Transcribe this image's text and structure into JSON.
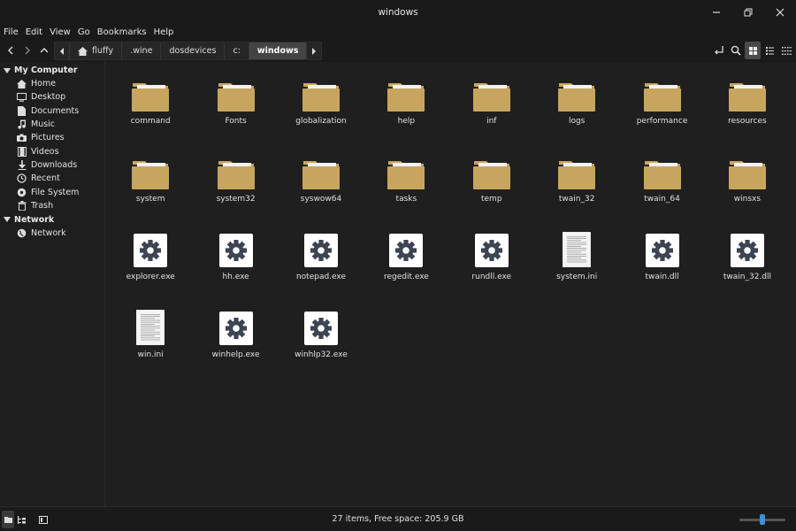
{
  "window": {
    "title": "windows"
  },
  "menu": [
    "File",
    "Edit",
    "View",
    "Go",
    "Bookmarks",
    "Help"
  ],
  "breadcrumbs": [
    {
      "label": "fluffy",
      "home": true
    },
    {
      "label": ".wine"
    },
    {
      "label": "dosdevices"
    },
    {
      "label": "c:"
    },
    {
      "label": "windows",
      "active": true
    }
  ],
  "sidebar": {
    "sections": [
      {
        "title": "My Computer",
        "items": [
          {
            "label": "Home",
            "icon": "home-icon"
          },
          {
            "label": "Desktop",
            "icon": "desktop-icon"
          },
          {
            "label": "Documents",
            "icon": "documents-icon"
          },
          {
            "label": "Music",
            "icon": "music-icon"
          },
          {
            "label": "Pictures",
            "icon": "pictures-icon"
          },
          {
            "label": "Videos",
            "icon": "videos-icon"
          },
          {
            "label": "Downloads",
            "icon": "downloads-icon"
          },
          {
            "label": "Recent",
            "icon": "recent-icon"
          },
          {
            "label": "File System",
            "icon": "filesystem-icon"
          },
          {
            "label": "Trash",
            "icon": "trash-icon"
          }
        ]
      },
      {
        "title": "Network",
        "items": [
          {
            "label": "Network",
            "icon": "network-icon"
          }
        ]
      }
    ]
  },
  "files": [
    {
      "name": "command",
      "type": "folder"
    },
    {
      "name": "Fonts",
      "type": "folder"
    },
    {
      "name": "globalization",
      "type": "folder"
    },
    {
      "name": "help",
      "type": "folder"
    },
    {
      "name": "inf",
      "type": "folder"
    },
    {
      "name": "logs",
      "type": "folder"
    },
    {
      "name": "performance",
      "type": "folder"
    },
    {
      "name": "resources",
      "type": "folder"
    },
    {
      "name": "system",
      "type": "folder"
    },
    {
      "name": "system32",
      "type": "folder"
    },
    {
      "name": "syswow64",
      "type": "folder"
    },
    {
      "name": "tasks",
      "type": "folder"
    },
    {
      "name": "temp",
      "type": "folder"
    },
    {
      "name": "twain_32",
      "type": "folder"
    },
    {
      "name": "twain_64",
      "type": "folder"
    },
    {
      "name": "winsxs",
      "type": "folder"
    },
    {
      "name": "explorer.exe",
      "type": "exe"
    },
    {
      "name": "hh.exe",
      "type": "exe"
    },
    {
      "name": "notepad.exe",
      "type": "exe"
    },
    {
      "name": "regedit.exe",
      "type": "exe"
    },
    {
      "name": "rundll.exe",
      "type": "exe"
    },
    {
      "name": "system.ini",
      "type": "text"
    },
    {
      "name": "twain.dll",
      "type": "exe"
    },
    {
      "name": "twain_32.dll",
      "type": "exe"
    },
    {
      "name": "win.ini",
      "type": "text"
    },
    {
      "name": "winhelp.exe",
      "type": "exe"
    },
    {
      "name": "winhlp32.exe",
      "type": "exe"
    }
  ],
  "status": {
    "text": "27 items, Free space: 205.9 GB",
    "zoom_level": 0.5
  },
  "colors": {
    "folder": "#c8a55e",
    "folder_tab": "#f2f2f2",
    "gear": "#3d4452",
    "accent": "#3d8fd1"
  }
}
